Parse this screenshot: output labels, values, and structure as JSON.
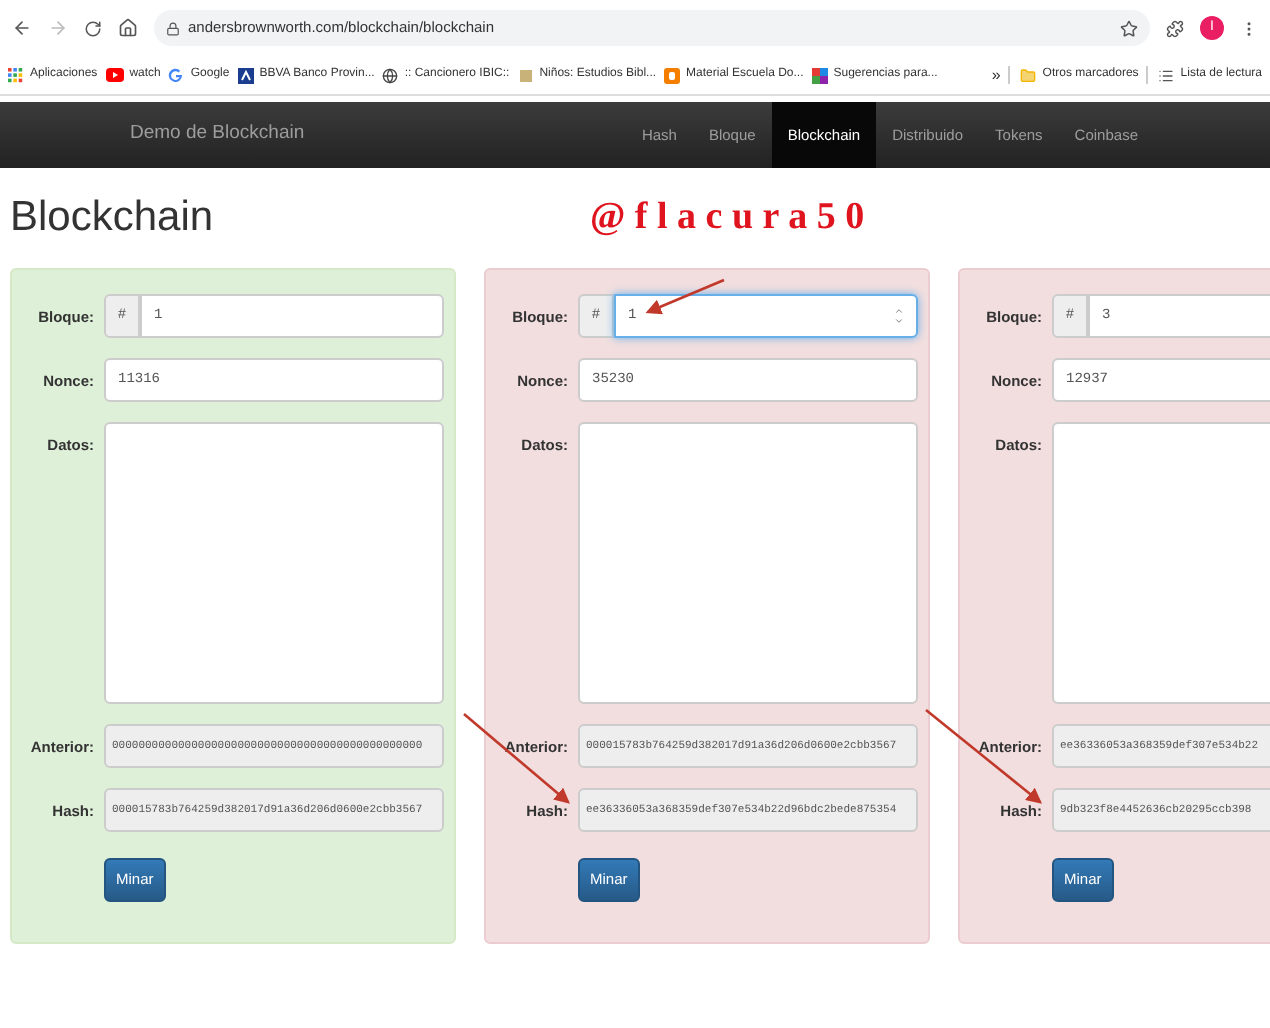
{
  "browser": {
    "url": "andersbrownworth.com/blockchain/blockchain",
    "profile_initial": "I",
    "bookmarks": [
      {
        "label": "Aplicaciones",
        "kind": "apps"
      },
      {
        "label": "watch",
        "kind": "video"
      },
      {
        "label": "Google",
        "kind": "google"
      },
      {
        "label": "BBVA Banco Provin...",
        "kind": "bank"
      },
      {
        "label": ":: Cancionero IBIC::",
        "kind": "globe"
      },
      {
        "label": "Niños: Estudios Bibl...",
        "kind": "small"
      },
      {
        "label": "Material Escuela Do...",
        "kind": "blog"
      },
      {
        "label": "Sugerencias para...",
        "kind": "grid"
      }
    ],
    "overflow": "»",
    "other_bookmarks": "Otros marcadores",
    "reading_list": "Lista de lectura"
  },
  "navbar": {
    "brand": "Demo de Blockchain",
    "items": [
      {
        "label": "Hash",
        "selected": false
      },
      {
        "label": "Bloque",
        "selected": false
      },
      {
        "label": "Blockchain",
        "selected": true
      },
      {
        "label": "Distribuido",
        "selected": false
      },
      {
        "label": "Tokens",
        "selected": false
      },
      {
        "label": "Coinbase",
        "selected": false
      }
    ]
  },
  "heading": "Blockchain",
  "annotation": "@ f l a c u r a 5 0",
  "blocks": [
    {
      "valid": true,
      "fields": [
        {
          "kind": "number",
          "label": "Bloque:",
          "prefix": "#",
          "value": "1",
          "focused": false
        },
        {
          "kind": "text",
          "label": "Nonce:",
          "value": "11316"
        },
        {
          "kind": "textarea",
          "label": "Datos:"
        },
        {
          "kind": "readonly",
          "label": "Anterior:",
          "value": "00000000000000000000000000000000000000000000000"
        },
        {
          "kind": "readonly",
          "label": "Hash:",
          "value": "000015783b764259d382017d91a36d206d0600e2cbb3567"
        }
      ],
      "button": "Minar"
    },
    {
      "valid": false,
      "fields": [
        {
          "kind": "number",
          "label": "Bloque:",
          "prefix": "#",
          "value": "1",
          "focused": true
        },
        {
          "kind": "text",
          "label": "Nonce:",
          "value": "35230"
        },
        {
          "kind": "textarea",
          "label": "Datos:"
        },
        {
          "kind": "readonly",
          "label": "Anterior:",
          "value": "000015783b764259d382017d91a36d206d0600e2cbb3567"
        },
        {
          "kind": "readonly",
          "label": "Hash:",
          "value": "ee36336053a368359def307e534b22d96bdc2bede875354"
        }
      ],
      "button": "Minar"
    },
    {
      "valid": false,
      "fields": [
        {
          "kind": "number",
          "label": "Bloque:",
          "prefix": "#",
          "value": "3",
          "focused": false
        },
        {
          "kind": "text",
          "label": "Nonce:",
          "value": "12937"
        },
        {
          "kind": "textarea",
          "label": "Datos:"
        },
        {
          "kind": "readonly",
          "label": "Anterior:",
          "value": "ee36336053a368359def307e534b22"
        },
        {
          "kind": "readonly",
          "label": "Hash:",
          "value": "9db323f8e4452636cb20295ccb398"
        }
      ],
      "button": "Minar"
    }
  ]
}
